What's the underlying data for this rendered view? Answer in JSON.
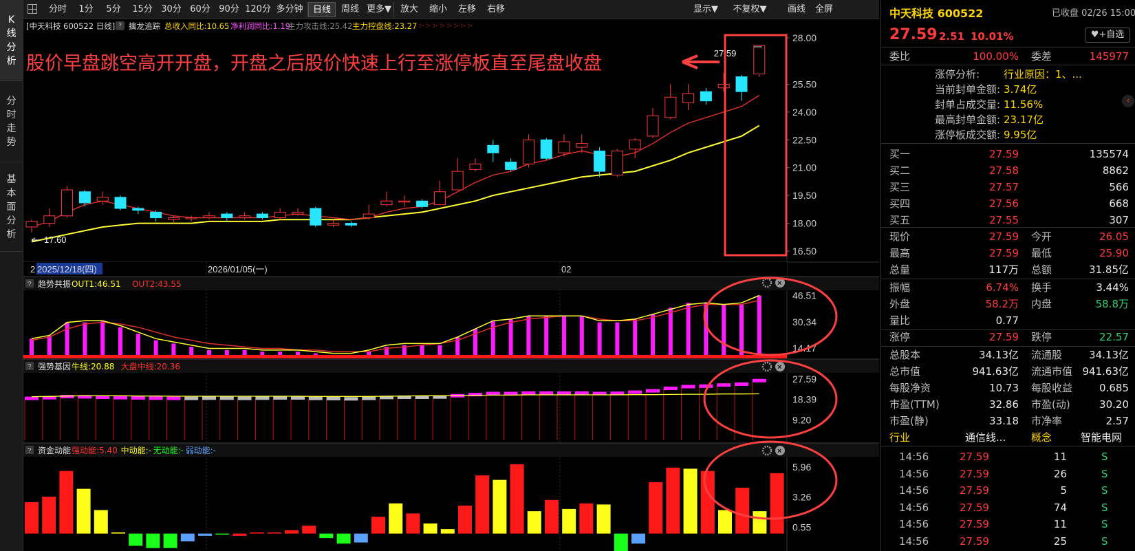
{
  "sidebar": {
    "tabs": [
      {
        "label": "K线分析",
        "chars": [
          "K",
          "线",
          "分",
          "析"
        ]
      },
      {
        "label": "分时走势",
        "chars": [
          "分",
          "时",
          "走",
          "势"
        ]
      },
      {
        "label": "基本面分析",
        "chars": [
          "基",
          "本",
          "面",
          "分",
          "析"
        ]
      }
    ]
  },
  "toolbar": {
    "grid_icon": "grid-icon",
    "left_buttons": [
      "分时",
      "1分",
      "5分",
      "15分",
      "30分",
      "60分",
      "90分",
      "120分",
      "多分钟",
      "日线",
      "周线",
      "更多▼",
      "放大",
      "缩小",
      "左移",
      "右移"
    ],
    "active_button": "日线",
    "right_buttons": [
      "显示▼",
      "不复权▼",
      "画线",
      "全屏"
    ]
  },
  "chart_info": {
    "title": "[中天科技 600522 日线]",
    "indicator_name": "擒龙追踪",
    "revenue_yoy": "总收入同比:10.65",
    "profit_yoy": "净利润同比:1.19",
    "attack_line": "主力攻击线:25.42",
    "control_line": "主力控盘线:23.27"
  },
  "annotation": {
    "text": "股价早盘跳空高开开盘，开盘之后股价快速上行至涨停板直至尾盘收盘",
    "color": "#ff4040"
  },
  "price_panel": {
    "y_ticks": [
      "28.00",
      "25.50",
      "24.00",
      "22.50",
      "21.00",
      "19.50",
      "18.00",
      "16.50"
    ],
    "high_label": "27.59",
    "low_label": "17.60",
    "date_labels": [
      "2",
      "2025/12/18(四)",
      "2026/01/05(一)",
      "02"
    ]
  },
  "chart_data": [
    {
      "type": "candlestick",
      "name": "price",
      "ylim": [
        16.5,
        28.0
      ],
      "ohlc": [
        [
          17.8,
          18.1,
          18.2,
          17.5
        ],
        [
          18.0,
          18.4,
          18.8,
          17.8
        ],
        [
          18.4,
          19.8,
          20.0,
          18.3
        ],
        [
          19.7,
          19.1,
          19.8,
          18.9
        ],
        [
          19.2,
          19.4,
          19.7,
          19.0
        ],
        [
          19.4,
          18.8,
          19.5,
          18.7
        ],
        [
          18.8,
          18.7,
          18.9,
          18.5
        ],
        [
          18.6,
          18.3,
          18.7,
          18.1
        ],
        [
          18.2,
          18.3,
          18.4,
          18.0
        ],
        [
          18.3,
          18.3,
          18.4,
          18.1
        ],
        [
          18.3,
          18.4,
          18.6,
          18.2
        ],
        [
          18.5,
          18.3,
          18.6,
          18.1
        ],
        [
          18.3,
          18.4,
          18.6,
          18.2
        ],
        [
          18.5,
          18.3,
          18.6,
          18.2
        ],
        [
          18.3,
          18.6,
          18.8,
          18.2
        ],
        [
          18.5,
          18.6,
          18.8,
          18.4
        ],
        [
          18.8,
          17.9,
          18.9,
          17.8
        ],
        [
          17.9,
          18.0,
          18.2,
          17.8
        ],
        [
          18.0,
          17.9,
          18.1,
          17.8
        ],
        [
          18.3,
          18.5,
          19.0,
          18.2
        ],
        [
          19.0,
          19.2,
          19.7,
          18.9
        ],
        [
          19.2,
          19.2,
          19.5,
          18.9
        ],
        [
          19.2,
          18.9,
          19.3,
          18.8
        ],
        [
          19.0,
          19.7,
          20.3,
          19.0
        ],
        [
          19.8,
          20.8,
          21.5,
          19.8
        ],
        [
          20.9,
          21.2,
          21.5,
          20.8
        ],
        [
          22.2,
          21.8,
          22.5,
          21.3
        ],
        [
          21.3,
          20.9,
          21.5,
          20.8
        ],
        [
          21.2,
          22.5,
          22.8,
          21.0
        ],
        [
          22.5,
          21.5,
          22.6,
          21.4
        ],
        [
          21.8,
          22.4,
          22.8,
          21.6
        ],
        [
          22.1,
          22.3,
          22.8,
          21.8
        ],
        [
          21.9,
          20.8,
          22.1,
          20.5
        ],
        [
          20.6,
          21.9,
          22.0,
          20.5
        ],
        [
          22.0,
          22.5,
          22.6,
          21.5
        ],
        [
          22.7,
          23.8,
          24.2,
          22.6
        ],
        [
          23.7,
          24.8,
          25.5,
          23.6
        ],
        [
          24.5,
          25.0,
          25.5,
          24.1
        ],
        [
          25.1,
          24.6,
          25.3,
          24.4
        ],
        [
          25.3,
          25.5,
          26.1,
          25.1
        ],
        [
          25.9,
          25.1,
          26.0,
          24.6
        ],
        [
          26.05,
          27.59,
          27.59,
          25.9
        ]
      ],
      "attack_line": [
        17.8,
        18.1,
        18.6,
        19.0,
        19.2,
        19.0,
        18.8,
        18.6,
        18.4,
        18.3,
        18.3,
        18.3,
        18.3,
        18.3,
        18.4,
        18.5,
        18.4,
        18.3,
        18.2,
        18.3,
        18.6,
        18.8,
        18.9,
        19.2,
        19.7,
        20.2,
        20.6,
        20.8,
        21.2,
        21.4,
        21.7,
        21.9,
        21.7,
        21.6,
        21.8,
        22.3,
        22.9,
        23.4,
        23.7,
        24.0,
        24.3,
        24.9
      ],
      "control_line": [
        17.0,
        17.2,
        17.4,
        17.6,
        17.8,
        17.9,
        18.0,
        18.0,
        18.0,
        18.0,
        18.1,
        18.1,
        18.1,
        18.1,
        18.2,
        18.2,
        18.2,
        18.2,
        18.2,
        18.3,
        18.4,
        18.5,
        18.6,
        18.8,
        19.0,
        19.2,
        19.5,
        19.7,
        19.9,
        20.1,
        20.3,
        20.5,
        20.6,
        20.7,
        20.8,
        21.1,
        21.4,
        21.8,
        22.1,
        22.4,
        22.7,
        23.27
      ]
    },
    {
      "type": "bar",
      "name": "趋势共振",
      "title": "趋势共振",
      "series_labels": [
        "OUT1:46.51",
        "OUT2:43.55"
      ],
      "y_ticks": [
        "46.51",
        "30.34",
        "14.17"
      ],
      "ylim": [
        10,
        48
      ],
      "values": [
        20,
        22,
        30,
        30,
        31,
        27,
        23,
        19,
        17,
        15,
        13,
        13,
        13,
        12,
        12,
        12,
        11,
        10,
        10,
        12,
        15,
        16,
        16,
        16,
        21,
        26,
        31,
        32,
        34,
        34,
        34,
        34,
        30,
        30,
        32,
        35,
        39,
        42,
        42,
        41,
        41,
        46.51
      ],
      "out1": [
        20,
        22,
        30,
        31,
        31,
        28,
        24,
        20,
        18,
        16,
        14,
        14,
        14,
        13,
        13,
        13,
        12,
        11,
        11,
        13,
        16,
        17,
        17,
        17,
        21,
        26,
        31,
        32,
        34,
        34,
        34,
        34,
        31,
        31,
        32,
        35,
        38,
        41,
        42,
        41,
        42,
        46.51
      ],
      "out2": [
        19,
        21,
        26,
        29,
        30,
        29,
        27,
        24,
        21,
        19,
        17,
        16,
        15,
        14,
        14,
        13,
        13,
        12,
        12,
        12,
        14,
        15,
        16,
        17,
        19,
        23,
        27,
        30,
        32,
        33,
        34,
        34,
        32,
        31,
        31,
        33,
        36,
        39,
        41,
        41,
        41,
        43.55
      ]
    },
    {
      "type": "bar",
      "name": "强势基因",
      "title": "强势基因",
      "series_labels": [
        "牛线:20.88",
        "大盘中线:20.36"
      ],
      "y_ticks": [
        "27.59",
        "18.39",
        "9.20"
      ],
      "ylim": [
        0,
        30
      ],
      "values": [
        19.6,
        19.9,
        20.4,
        20.3,
        20.1,
        19.9,
        19.8,
        19.7,
        19.6,
        19.6,
        19.7,
        19.7,
        19.6,
        19.7,
        19.8,
        19.8,
        19.6,
        19.5,
        19.4,
        19.6,
        20.0,
        20.1,
        20.1,
        20.2,
        20.8,
        21.3,
        21.8,
        21.8,
        22.0,
        22.0,
        22.0,
        22.0,
        21.8,
        21.9,
        22.4,
        23.0,
        24.1,
        24.9,
        25.1,
        25.6,
        26.0,
        27.59
      ],
      "bull_line": [
        19.6,
        19.7,
        19.9,
        20.0,
        20.0,
        20.0,
        19.9,
        19.9,
        19.8,
        19.8,
        19.8,
        19.8,
        19.8,
        19.8,
        19.8,
        19.8,
        19.7,
        19.7,
        19.7,
        19.7,
        19.8,
        19.9,
        20.0,
        20.0,
        20.1,
        20.2,
        20.3,
        20.3,
        20.4,
        20.4,
        20.4,
        20.4,
        20.4,
        20.4,
        20.5,
        20.5,
        20.6,
        20.7,
        20.7,
        20.8,
        20.8,
        20.88
      ]
    },
    {
      "type": "bar",
      "name": "资金动能",
      "title": "资金动能",
      "series_labels": [
        "强动能:5.40",
        "中动能:-",
        "无动能:-",
        "弱动能:-"
      ],
      "y_ticks": [
        "5.96",
        "3.26",
        "0.55"
      ],
      "ylim": [
        -1.5,
        6.5
      ],
      "values": [
        2.8,
        3.3,
        5.6,
        4.0,
        2.1,
        0.1,
        -1.1,
        -1.3,
        -1.3,
        -0.7,
        -0.2,
        -0.1,
        -0.2,
        0.1,
        0.1,
        0.3,
        0.7,
        -0.4,
        -0.9,
        -0.8,
        1.5,
        2.7,
        1.8,
        0.9,
        0.4,
        2.5,
        5.2,
        4.8,
        6.2,
        2.0,
        3.0,
        2.2,
        2.7,
        2.6,
        -1.6,
        -0.9,
        4.6,
        5.9,
        5.8,
        5.6,
        2.1,
        4.1,
        2.0,
        5.4
      ],
      "colors": [
        "#ff1a1a",
        "#ff1a1a",
        "#ff1a1a",
        "#ffff1a",
        "#ffff1a",
        "#ffff1a",
        "#19ff19",
        "#19ff19",
        "#19ff19",
        "#5aa0ff",
        "#5aa0ff",
        "#19ff19",
        "#ff1a1a",
        "#ff1a1a",
        "#ff1a1a",
        "#ff1a1a",
        "#ff1a1a",
        "#19ff19",
        "#19ff19",
        "#5aa0ff",
        "#ff1a1a",
        "#ffff1a",
        "#ff1a1a",
        "#ffff1a",
        "#ffff1a",
        "#ff1a1a",
        "#ff1a1a",
        "#ffff1a",
        "#ff1a1a",
        "#ffff1a",
        "#ff1a1a",
        "#ffff1a",
        "#ff1a1a",
        "#ffff1a",
        "#19ff19",
        "#5aa0ff",
        "#ff1a1a",
        "#ff1a1a",
        "#ffff1a",
        "#ff1a1a",
        "#ffff1a",
        "#ff1a1a",
        "#ffff1a",
        "#ff1a1a"
      ]
    }
  ],
  "panel_icons": [
    "question-icon",
    "gear-icon",
    "close-icon"
  ],
  "quote": {
    "name_code": "中天科技 600522",
    "status": "已收盘 02/26 15:00",
    "price": "27.59",
    "change": "2.51",
    "change_pct": "10.01%",
    "watch_button": "+自选",
    "wei_bi_label": "委比",
    "wei_bi": "100.00%",
    "wei_cha_label": "委差",
    "wei_cha": "145977",
    "limit_analysis": [
      {
        "label": "涨停分析:",
        "value": "行业原因：1、..."
      },
      {
        "label": "当前封单金额:",
        "value": "3.74亿"
      },
      {
        "label": "封单占成交量:",
        "value": "11.56%"
      },
      {
        "label": "最高封单金额:",
        "value": "23.17亿"
      },
      {
        "label": "涨停板成交额:",
        "value": "9.95亿"
      }
    ],
    "bids": [
      {
        "label": "买一",
        "price": "27.59",
        "vol": "135574"
      },
      {
        "label": "买二",
        "price": "27.58",
        "vol": "8862"
      },
      {
        "label": "买三",
        "price": "27.57",
        "vol": "566"
      },
      {
        "label": "买四",
        "price": "27.56",
        "vol": "668"
      },
      {
        "label": "买五",
        "price": "27.55",
        "vol": "307"
      }
    ],
    "stats": [
      {
        "l1": "现价",
        "v1": "27.59",
        "c1": "red",
        "l2": "今开",
        "v2": "26.05",
        "c2": "red"
      },
      {
        "l1": "最高",
        "v1": "27.59",
        "c1": "red",
        "l2": "最低",
        "v2": "25.90",
        "c2": "red"
      },
      {
        "l1": "总量",
        "v1": "117万",
        "c1": "white",
        "l2": "总额",
        "v2": "31.85亿",
        "c2": "white"
      },
      {
        "l1": "振幅",
        "v1": "6.74%",
        "c1": "red",
        "l2": "换手",
        "v2": "3.44%",
        "c2": "white"
      },
      {
        "l1": "外盘",
        "v1": "58.2万",
        "c1": "red",
        "l2": "内盘",
        "v2": "58.8万",
        "c2": "green"
      },
      {
        "l1": "量比",
        "v1": "0.77",
        "c1": "white",
        "l2": "",
        "v2": "",
        "c2": "white"
      },
      {
        "l1": "涨停",
        "v1": "27.59",
        "c1": "red",
        "l2": "跌停",
        "v2": "22.57",
        "c2": "green"
      },
      {
        "l1": "总股本",
        "v1": "34.13亿",
        "c1": "white",
        "l2": "流通股",
        "v2": "34.13亿",
        "c2": "white"
      },
      {
        "l1": "总市值",
        "v1": "941.63亿",
        "c1": "white",
        "l2": "流通市值",
        "v2": "941.63亿",
        "c2": "white"
      },
      {
        "l1": "每股净资",
        "v1": "10.73",
        "c1": "white",
        "l2": "每股收益",
        "v2": "0.685",
        "c2": "white"
      },
      {
        "l1": "市盈(TTM)",
        "v1": "32.86",
        "c1": "white",
        "l2": "市盈(动)",
        "v2": "30.20",
        "c2": "white"
      },
      {
        "l1": "市盈(静)",
        "v1": "33.18",
        "c1": "white",
        "l2": "市净率",
        "v2": "2.57",
        "c2": "white"
      }
    ],
    "industry": {
      "l1": "行业",
      "v1": "通信线...",
      "l2": "概念",
      "v2": "智能电网"
    },
    "ticks": [
      {
        "time": "14:56",
        "price": "27.59",
        "vol": "11",
        "side": "S"
      },
      {
        "time": "14:56",
        "price": "27.59",
        "vol": "26",
        "side": "S"
      },
      {
        "time": "14:56",
        "price": "27.59",
        "vol": "5",
        "side": "S"
      },
      {
        "time": "14:56",
        "price": "27.59",
        "vol": "74",
        "side": "S"
      },
      {
        "time": "14:56",
        "price": "27.59",
        "vol": "11",
        "side": "S"
      },
      {
        "time": "14:56",
        "price": "27.59",
        "vol": "25",
        "side": "S"
      }
    ]
  }
}
